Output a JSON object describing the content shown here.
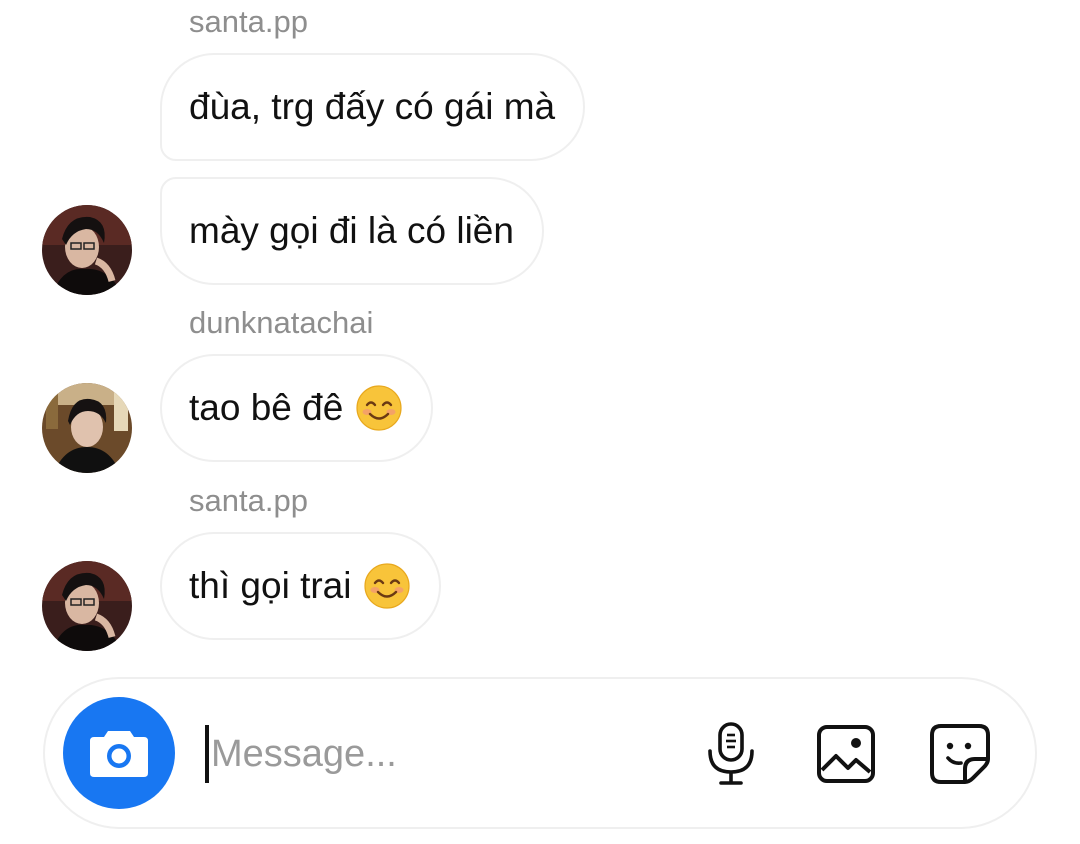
{
  "messages": [
    {
      "sender": "santa.pp",
      "text": "đùa, trg đấy có gái mà"
    },
    {
      "text": "mày gọi đi là có liền"
    },
    {
      "sender": "dunknatachai",
      "text": "tao bê đê"
    },
    {
      "sender": "santa.pp",
      "text": "thì gọi trai"
    }
  ],
  "emoji": {
    "name": "smiling-face-with-smiling-eyes",
    "color": "#F8C43A"
  },
  "composer": {
    "placeholder": "Message...",
    "value": "",
    "camera_icon": "camera-icon",
    "tools": [
      "microphone-icon",
      "gallery-icon",
      "sticker-icon"
    ]
  },
  "colors": {
    "accent": "#1877F2",
    "sender_label": "#8E8E8E",
    "bubble_border": "#EFEFEF"
  }
}
